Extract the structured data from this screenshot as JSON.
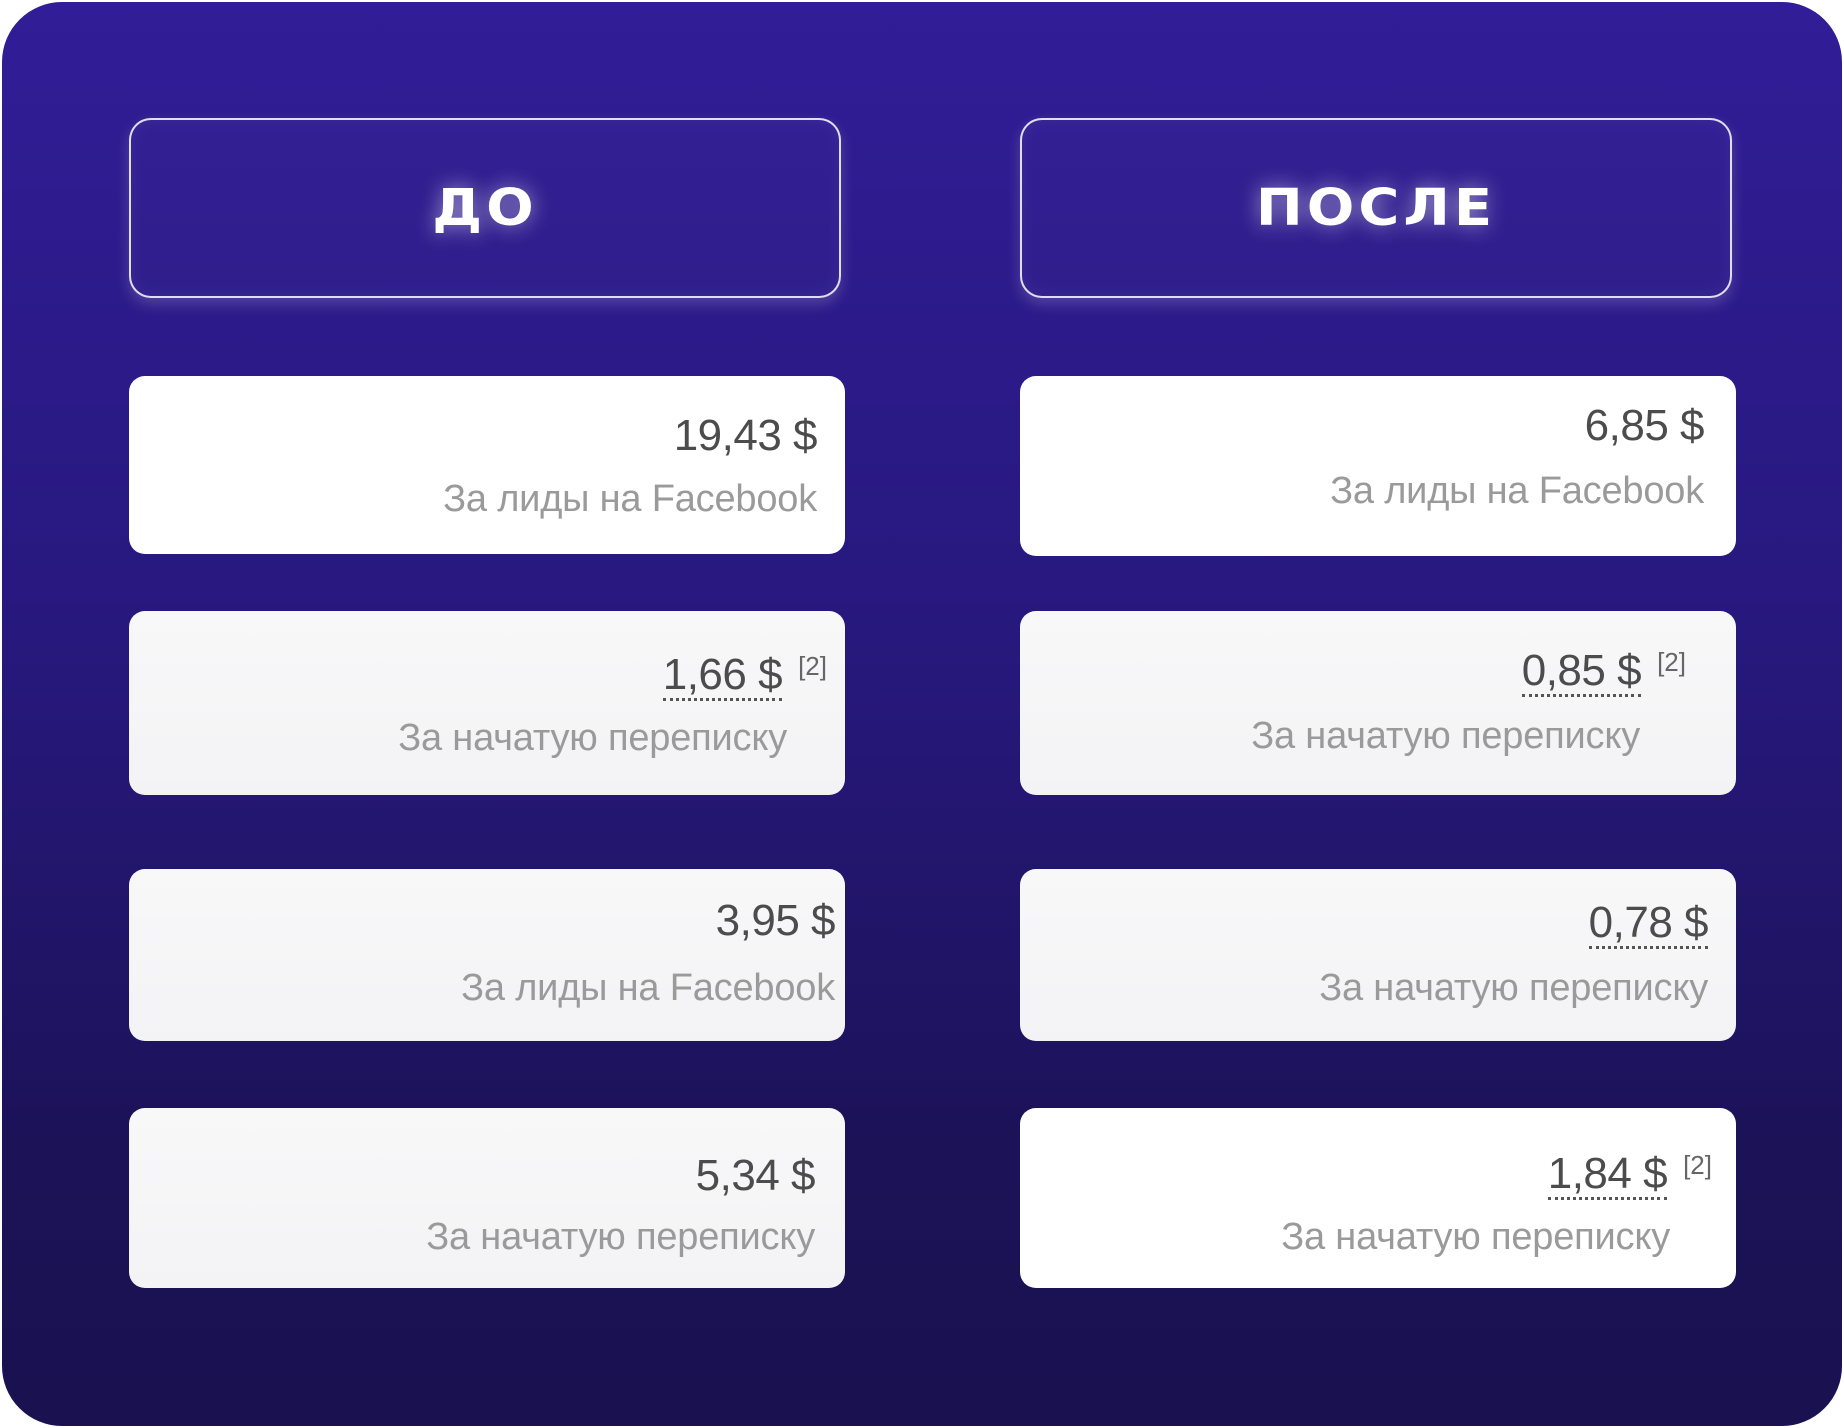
{
  "headers": {
    "left": "ДО",
    "right": "ПОСЛЕ"
  },
  "before": [
    {
      "value": "19,43 $",
      "caption": "За лиды на Facebook"
    },
    {
      "value": "1,66 $",
      "ref": "[2]",
      "caption": "За начатую переписку"
    },
    {
      "value": "3,95 $",
      "caption": "За лиды на Facebook"
    },
    {
      "value": "5,34 $",
      "caption": "За начатую переписку"
    }
  ],
  "after": [
    {
      "value": "6,85 $",
      "caption": "За лиды на Facebook"
    },
    {
      "value": "0,85 $",
      "ref": "[2]",
      "caption": "За начатую переписку"
    },
    {
      "value": "0,78 $",
      "caption": "За начатую переписку"
    },
    {
      "value": "1,84 $",
      "ref": "[2]",
      "caption": "За начатую переписку"
    }
  ]
}
